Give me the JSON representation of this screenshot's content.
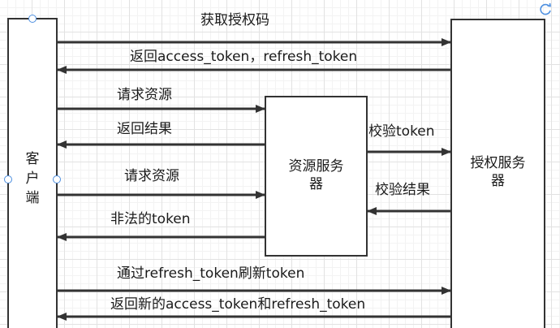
{
  "nodes": {
    "client": "客\n户\n端",
    "resource_server": "资源服务\n器",
    "auth_server": "授权服务\n器"
  },
  "messages": {
    "m1": "获取授权码",
    "m2": "返回access_token，refresh_token",
    "m3": "请求资源",
    "m4": "返回结果",
    "m5": "校验token",
    "m6": "请求资源",
    "m7": "校验结果",
    "m8": "非法的token",
    "m9": "通过refresh_token刷新token",
    "m10": "返回新的access_token和refresh_token"
  },
  "colors": {
    "line": "#333333",
    "handle": "#4d8fe0"
  },
  "icons": {
    "corner": "refresh-icon"
  }
}
